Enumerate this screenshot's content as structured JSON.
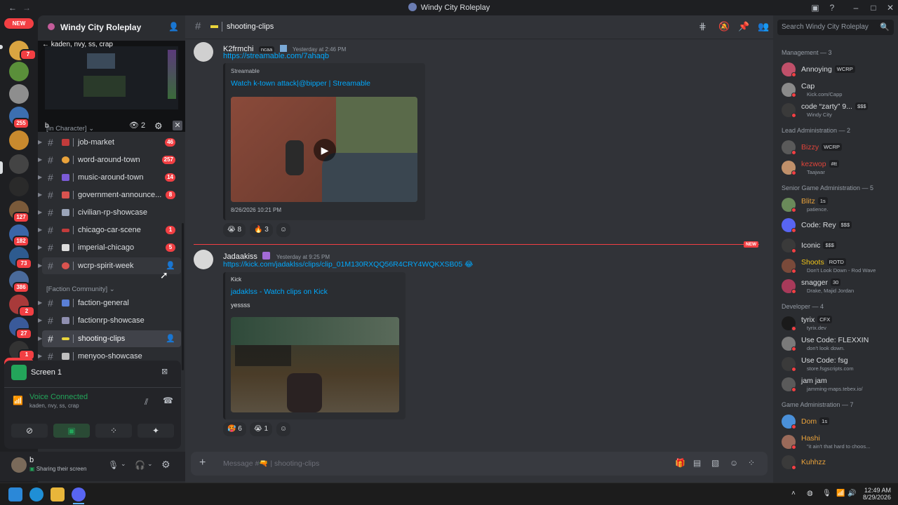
{
  "window": {
    "title": "Windy City Roleplay"
  },
  "rail": {
    "new_top": "NEW",
    "new_bottom": "NEW",
    "badges": [
      "7",
      "255",
      "127",
      "182",
      "73",
      "386",
      "2",
      "27",
      "1"
    ]
  },
  "server": {
    "name": "Windy City Roleplay"
  },
  "stream": {
    "title": "kaden, nvy, ss, crap",
    "user": "b",
    "viewers": "2"
  },
  "categories": {
    "in_character": "[In Character]",
    "faction": "[Faction Community]"
  },
  "channels": [
    {
      "name": "job-market",
      "count": "46",
      "color": "#c23b3b"
    },
    {
      "name": "word-around-town",
      "count": "257",
      "color": "#e9a23b"
    },
    {
      "name": "music-around-town",
      "count": "14",
      "color": "#7b5bd6"
    },
    {
      "name": "government-announce...",
      "count": "8",
      "color": "#d9534f"
    },
    {
      "name": "civilian-rp-showcase",
      "count": "",
      "color": "#9aa4b8"
    },
    {
      "name": "chicago-car-scene",
      "count": "1",
      "color": "#c23b3b"
    },
    {
      "name": "imperial-chicago",
      "count": "5",
      "color": "#dcdcdc"
    },
    {
      "name": "wcrp-spirit-week",
      "count": "",
      "color": "#d9534f"
    },
    {
      "name": "faction-general",
      "count": "",
      "color": "#5a7fd6"
    },
    {
      "name": "factionrp-showcase",
      "count": "",
      "color": "#8f8fb0"
    },
    {
      "name": "shooting-clips",
      "count": "",
      "color": "#e9d43b"
    },
    {
      "name": "menyoo-showcase",
      "count": "",
      "color": "#bfbfbf"
    }
  ],
  "voice": {
    "screen_label": "Screen 1",
    "status": "Voice Connected",
    "sub": "kaden, nvy, ss, crap"
  },
  "user": {
    "name": "b",
    "status": "Sharing their screen"
  },
  "channel_header": {
    "name": "shooting-clips",
    "search_placeholder": "Search Windy City Roleplay"
  },
  "messages": [
    {
      "author": "K2frmchi",
      "tag": "ncaa",
      "time": "Yesterday at 2:46 PM",
      "link": "https://streamable.com/7ahaqb",
      "embed_provider": "Streamable",
      "embed_title": "Watch k-town attack|@bipper | Streamable",
      "embed_footer": "8/26/2026 10:21 PM",
      "reactions": [
        {
          "emoji": "😭",
          "count": "8"
        },
        {
          "emoji": "🔥",
          "count": "3"
        }
      ]
    },
    {
      "author": "Jadaakiss",
      "time": "Yesterday at 9:25 PM",
      "link": "https://kick.com/jadaklss/clips/clip_01M130RXQQ56R4CRY4WQKXSB05",
      "embed_provider": "Kick",
      "embed_title": "jadaklss - Watch clips on Kick",
      "embed_desc": "yessss",
      "reactions": [
        {
          "emoji": "🥵",
          "count": "6"
        },
        {
          "emoji": "😭",
          "count": "1"
        }
      ]
    }
  ],
  "new_divider": "NEW",
  "composer": {
    "placeholder": "Message #🔫 | shooting-clips"
  },
  "member_groups": [
    {
      "label": "Management — 3",
      "members": [
        {
          "name": "Annoying",
          "tag": "WCRP",
          "sub": "",
          "color": "#dbdee1"
        },
        {
          "name": "Cap",
          "tag": "",
          "sub": "Kick.com/Capp",
          "color": "#dbdee1"
        },
        {
          "name": "code “zarty” 9...",
          "tag": "$$$",
          "sub": "Windy City",
          "color": "#dbdee1"
        }
      ]
    },
    {
      "label": "Lead Administration — 2",
      "members": [
        {
          "name": "Bizzy",
          "tag": "WCRP",
          "sub": "",
          "color": "#e0443a"
        },
        {
          "name": "kezwop",
          "tag": "#tt",
          "sub": "Taajwar",
          "color": "#e0443a"
        }
      ]
    },
    {
      "label": "Senior Game Administration — 5",
      "members": [
        {
          "name": "Blitz",
          "tag": "1s",
          "sub": "patience.",
          "color": "#e9a23b"
        },
        {
          "name": "Code: Rey",
          "tag": "$$$",
          "sub": "",
          "color": "#dbdee1"
        },
        {
          "name": "Iconic",
          "tag": "$$$",
          "sub": "",
          "color": "#dbdee1"
        },
        {
          "name": "Shoots",
          "tag": "ROTD",
          "sub": "Don't Look Down - Rod Wave",
          "color": "#f0c419"
        },
        {
          "name": "snagger",
          "tag": "30",
          "sub": "Drake, Majid Jordan",
          "color": "#dbdee1"
        }
      ]
    },
    {
      "label": "Developer — 4",
      "members": [
        {
          "name": "tyrix",
          "tag": "CFX",
          "sub": "tyrix.dev",
          "color": "#dbdee1"
        },
        {
          "name": "Use Code: FLEXXIN",
          "tag": "",
          "sub": "don't look down.",
          "color": "#dbdee1"
        },
        {
          "name": "Use Code: fsg",
          "tag": "",
          "sub": "store.fsgscripts.com",
          "color": "#dbdee1"
        },
        {
          "name": "jam jam",
          "tag": "",
          "sub": "jamming-maps.tebex.io/",
          "color": "#dbdee1"
        }
      ]
    },
    {
      "label": "Game Administration — 7",
      "members": [
        {
          "name": "Dom",
          "tag": "1s",
          "sub": "",
          "color": "#e9a23b"
        },
        {
          "name": "Hashi",
          "tag": "",
          "sub": "\"it ain't that hard to choos...",
          "color": "#e9a23b"
        },
        {
          "name": "Kuhhzz",
          "tag": "",
          "sub": "",
          "color": "#e9a23b"
        }
      ]
    }
  ],
  "clock": {
    "time": "12:49 AM",
    "date": "8/29/2026"
  }
}
